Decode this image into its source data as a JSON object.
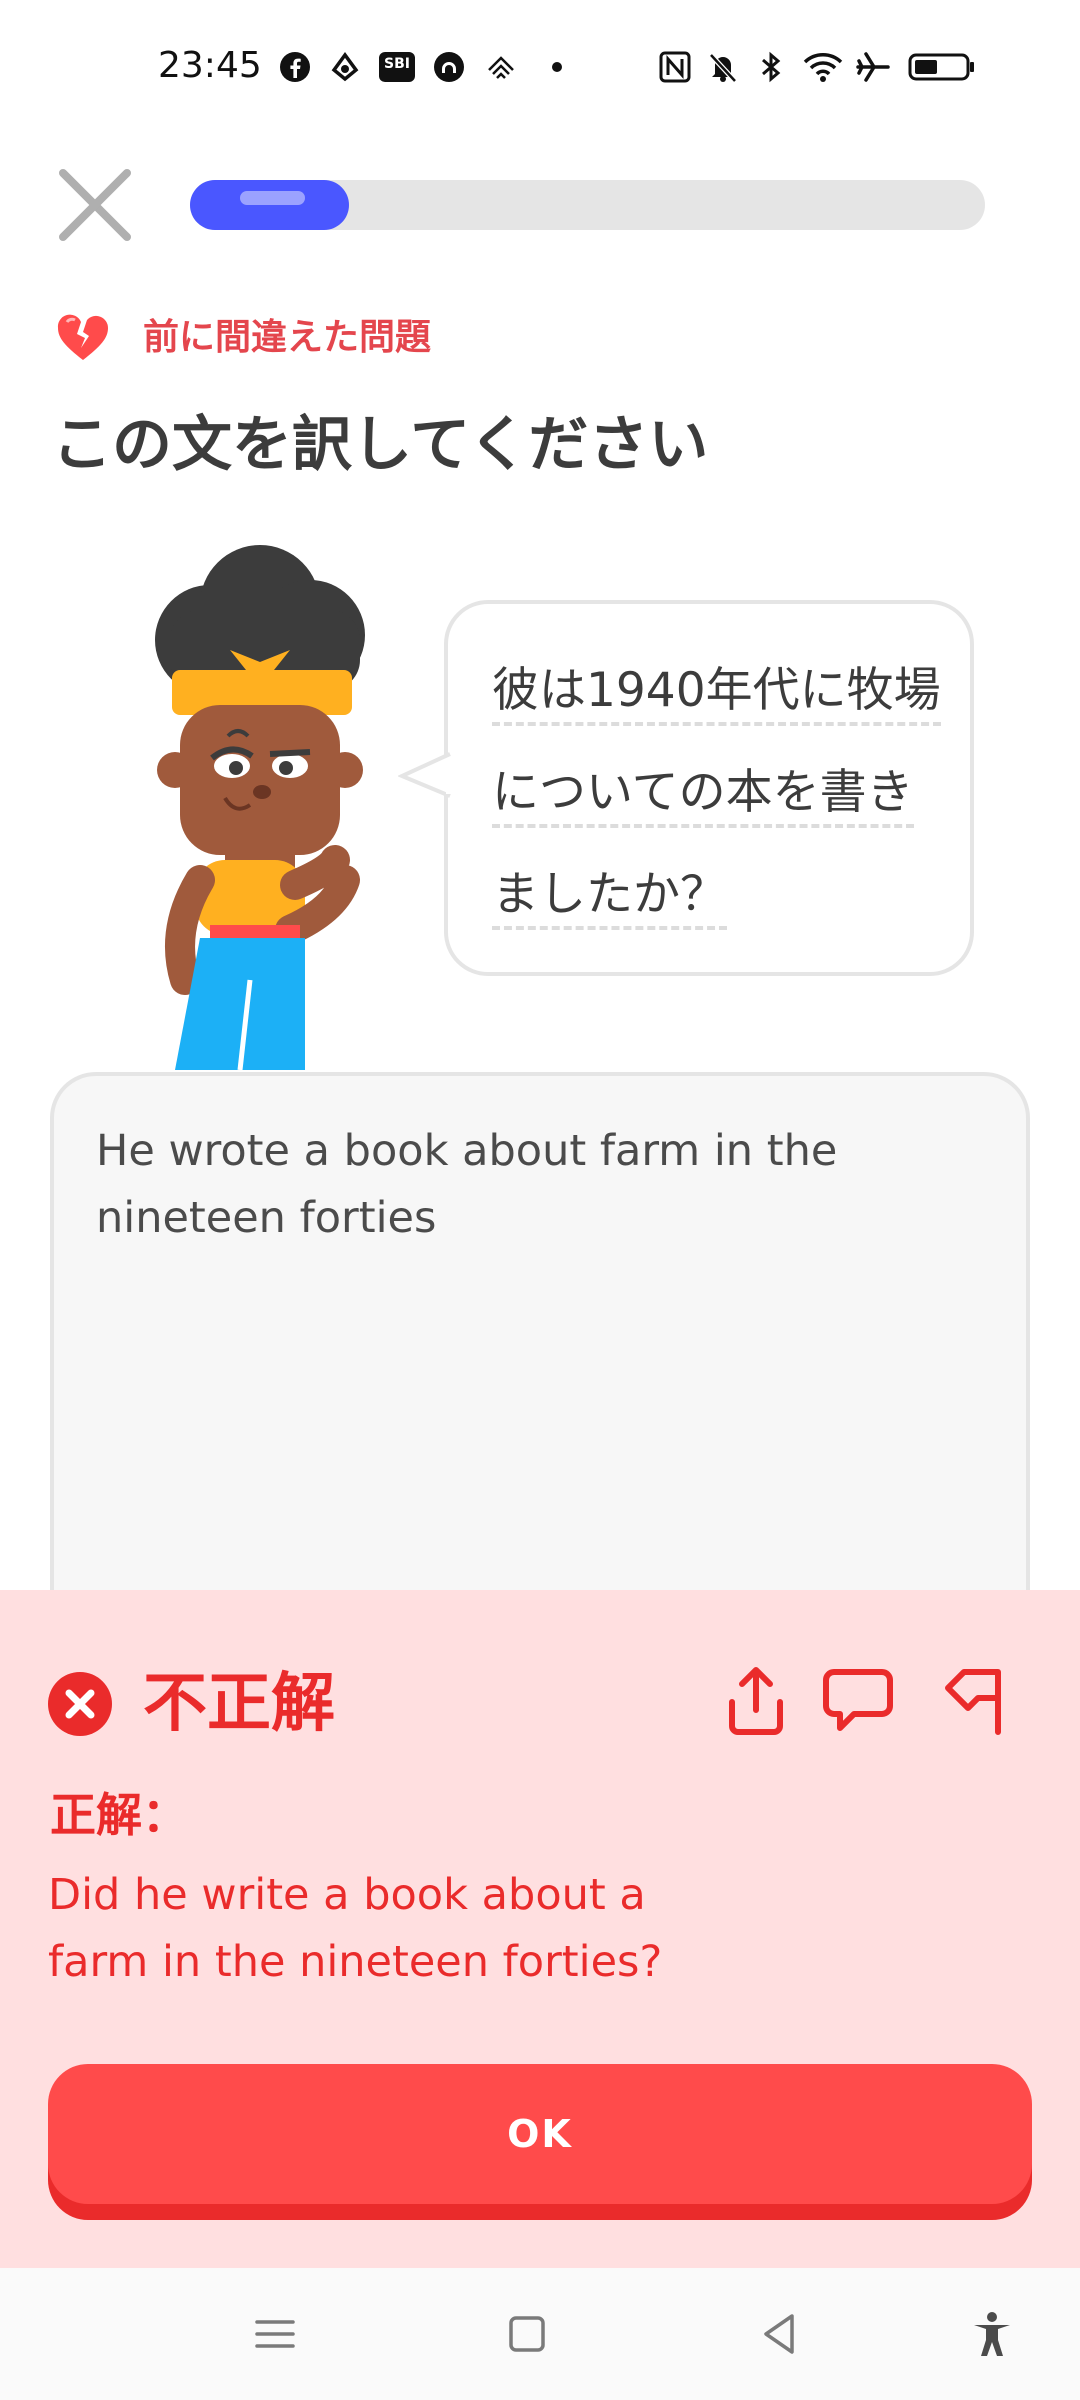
{
  "status_bar": {
    "time": "23:45",
    "left_icons": [
      "facebook-icon",
      "app-icon",
      "sbi-icon",
      "app-circle-icon",
      "app-icon",
      "dot-icon"
    ],
    "right_icons": [
      "nfc-icon",
      "bell-muted-icon",
      "bluetooth-icon",
      "wifi-icon",
      "airplane-icon",
      "battery-icon"
    ],
    "sbi_text": "SBI"
  },
  "progress": {
    "fraction": 0.2,
    "color": "#4a57ff"
  },
  "lesson": {
    "mistake_label": "前に間違えた問題",
    "instruction": "この文を訳してください",
    "prompt_lines": [
      "彼は1940年代に牧場",
      "についての本を書き",
      "ましたか？"
    ]
  },
  "answer": {
    "text": "He wrote a book about farm in the nineteen forties"
  },
  "feedback": {
    "title": "不正解",
    "correct_label": "正解：",
    "correct_answer": "Did he write a book about a farm in the nineteen forties?",
    "ok_label": "OK",
    "color": "#ea2b2b",
    "background": "#ffdfe0"
  },
  "nav": {
    "icons": [
      "menu-icon",
      "home-square-icon",
      "back-triangle-icon",
      "accessibility-icon"
    ]
  }
}
